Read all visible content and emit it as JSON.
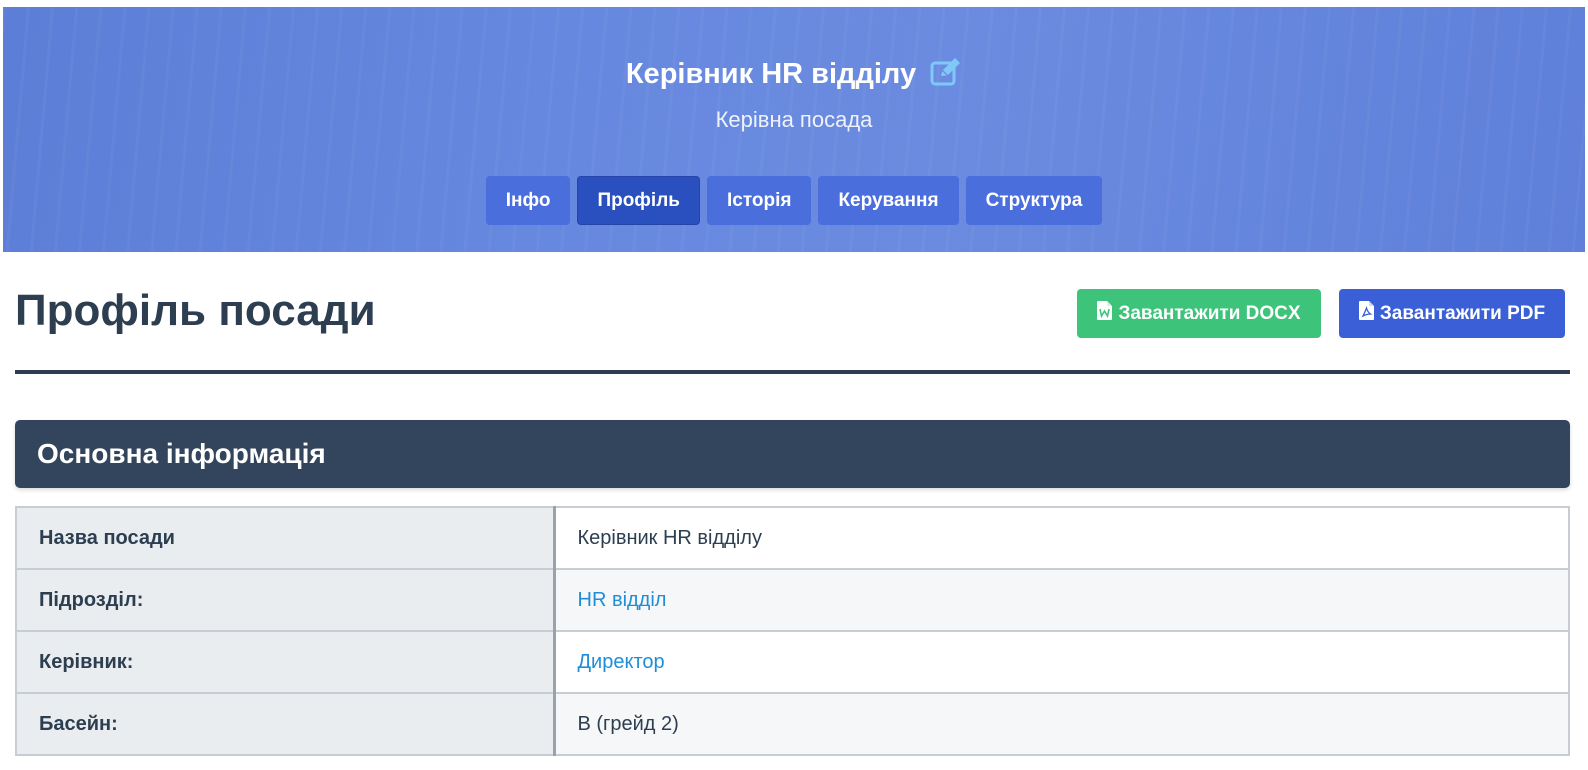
{
  "hero": {
    "title": "Керівник HR відділу",
    "subtitle": "Керівна посада",
    "edit_icon": "edit-icon",
    "tabs": [
      {
        "label": "Інфо",
        "active": false
      },
      {
        "label": "Профіль",
        "active": true
      },
      {
        "label": "Історія",
        "active": false
      },
      {
        "label": "Керування",
        "active": false
      },
      {
        "label": "Структура",
        "active": false
      }
    ]
  },
  "page": {
    "title": "Профіль посади",
    "download_docx_label": "Завантажити DOCX",
    "download_pdf_label": "Завантажити PDF"
  },
  "section": {
    "title": "Основна інформація",
    "rows": [
      {
        "label": "Назва посади",
        "value": "Керівник HR відділу",
        "link": false
      },
      {
        "label": "Підрозділ:",
        "value": "HR відділ",
        "link": true
      },
      {
        "label": "Керівник:",
        "value": "Директор",
        "link": true
      },
      {
        "label": "Басейн:",
        "value": "B (грейд 2)",
        "link": false
      }
    ]
  },
  "colors": {
    "hero_background": "#6688de",
    "tab": "#4a6fdc",
    "tab_active": "#2a4fbf",
    "docx_button": "#3ec47a",
    "pdf_button": "#3b5fd6",
    "section_header": "#33455c",
    "link": "#1f8ed6",
    "edit_icon": "#7fc8f8"
  }
}
